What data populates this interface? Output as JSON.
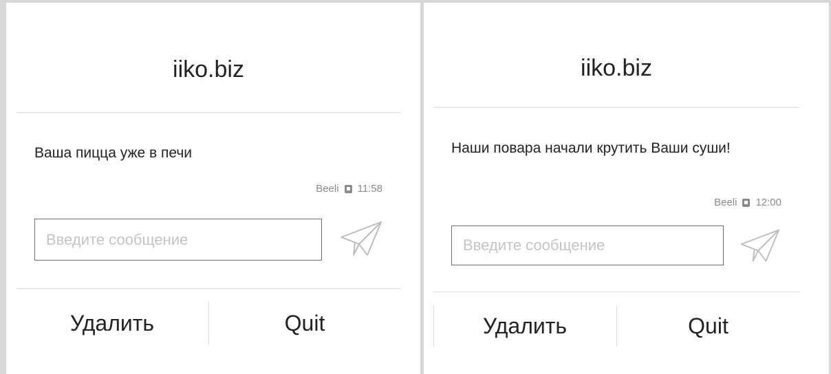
{
  "notifications": [
    {
      "title": "iiko.biz",
      "message": "Ваша пицца уже в печи",
      "sender": "Beeli",
      "time": "11:58",
      "input_placeholder": "Введите сообщение",
      "send_icon": "paper-plane-icon",
      "delete_label": "Удалить",
      "quit_label": "Quit"
    },
    {
      "title": "iiko.biz",
      "message": "Наши повара начали крутить Ваши суши!",
      "sender": "Beeli",
      "time": "12:00",
      "input_placeholder": "Введите сообщение",
      "send_icon": "paper-plane-icon",
      "delete_label": "Удалить",
      "quit_label": "Quit"
    }
  ],
  "colors": {
    "frame": "#d7d7d7",
    "text": "#222222",
    "meta": "#8a8a8a",
    "placeholder": "#c4c4c4"
  }
}
